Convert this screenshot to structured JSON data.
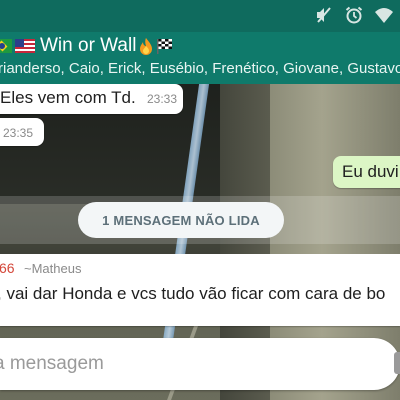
{
  "status_bar": {
    "icons": [
      "mute-icon",
      "alarm-icon",
      "wifi-icon"
    ]
  },
  "header": {
    "flags": [
      "brazil-flag-icon",
      "usa-flag-icon"
    ],
    "title": "Win or Wall",
    "title_emojis": [
      "fire-icon",
      "checkered-flag-icon"
    ],
    "members": "rianderso, Caio, Erick, Eusébio, Frenético, Giovane, Gustavo, J"
  },
  "messages": [
    {
      "type": "incoming",
      "text": "Eles vem com Td.",
      "time": "23:33"
    },
    {
      "type": "incoming",
      "text": "",
      "time": "23:35"
    },
    {
      "type": "outgoing",
      "text": "Eu duvi"
    },
    {
      "type": "unread_banner",
      "text": "1 MENSAGEM NÃO LIDA"
    },
    {
      "type": "incoming",
      "sender_phone": "66",
      "sender_name": "~Matheus",
      "text": ", vai dar Honda e vcs tudo vão ficar com cara de bo"
    }
  ],
  "composer": {
    "placeholder": "a mensagem"
  },
  "colors": {
    "header": "#0f7a6b",
    "status_bar": "#0f6b5e",
    "outgoing_bubble": "#dcf6c5",
    "sender_phone": "#d4473a"
  }
}
